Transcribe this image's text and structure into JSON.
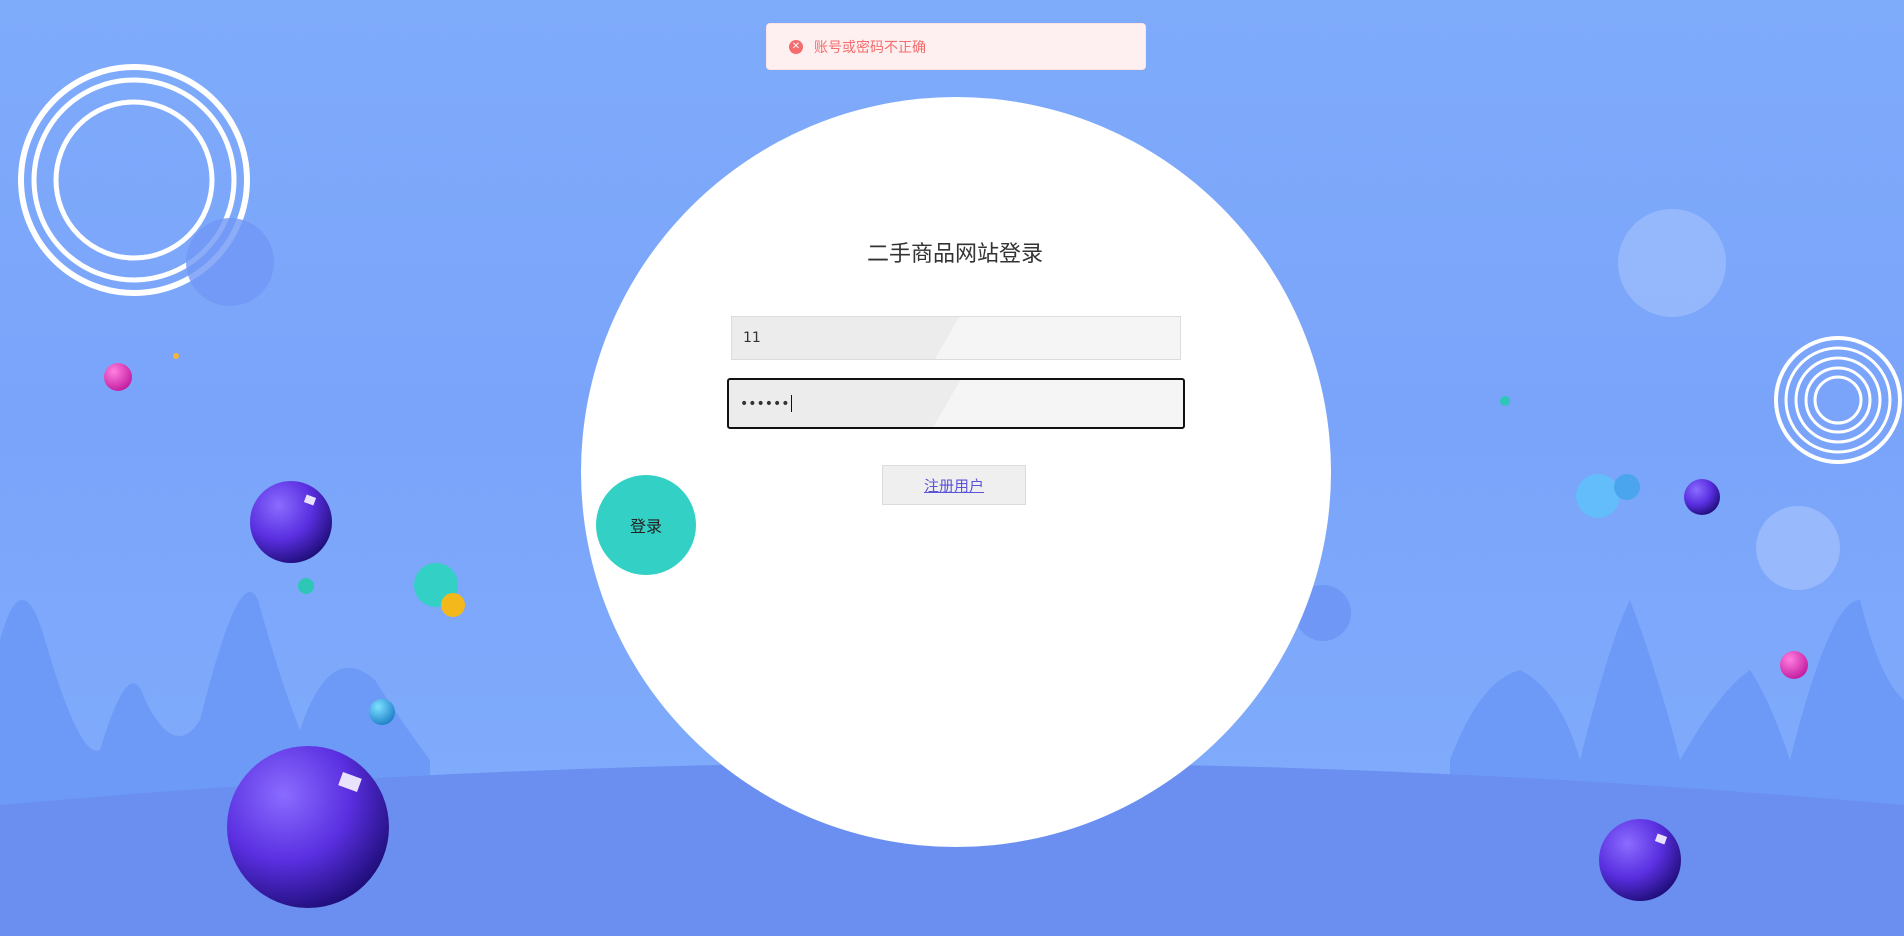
{
  "toast": {
    "message": "账号或密码不正确",
    "icon": "error-circle-icon",
    "color": "#f56c6c"
  },
  "login": {
    "title": "二手商品网站登录",
    "username_value": "11",
    "password_value": "••••••",
    "register_label": "注册用户",
    "submit_label": "登录"
  },
  "colors": {
    "background": "#7fabfb",
    "accent_teal": "#33d1c5",
    "link": "#5b53d8"
  }
}
